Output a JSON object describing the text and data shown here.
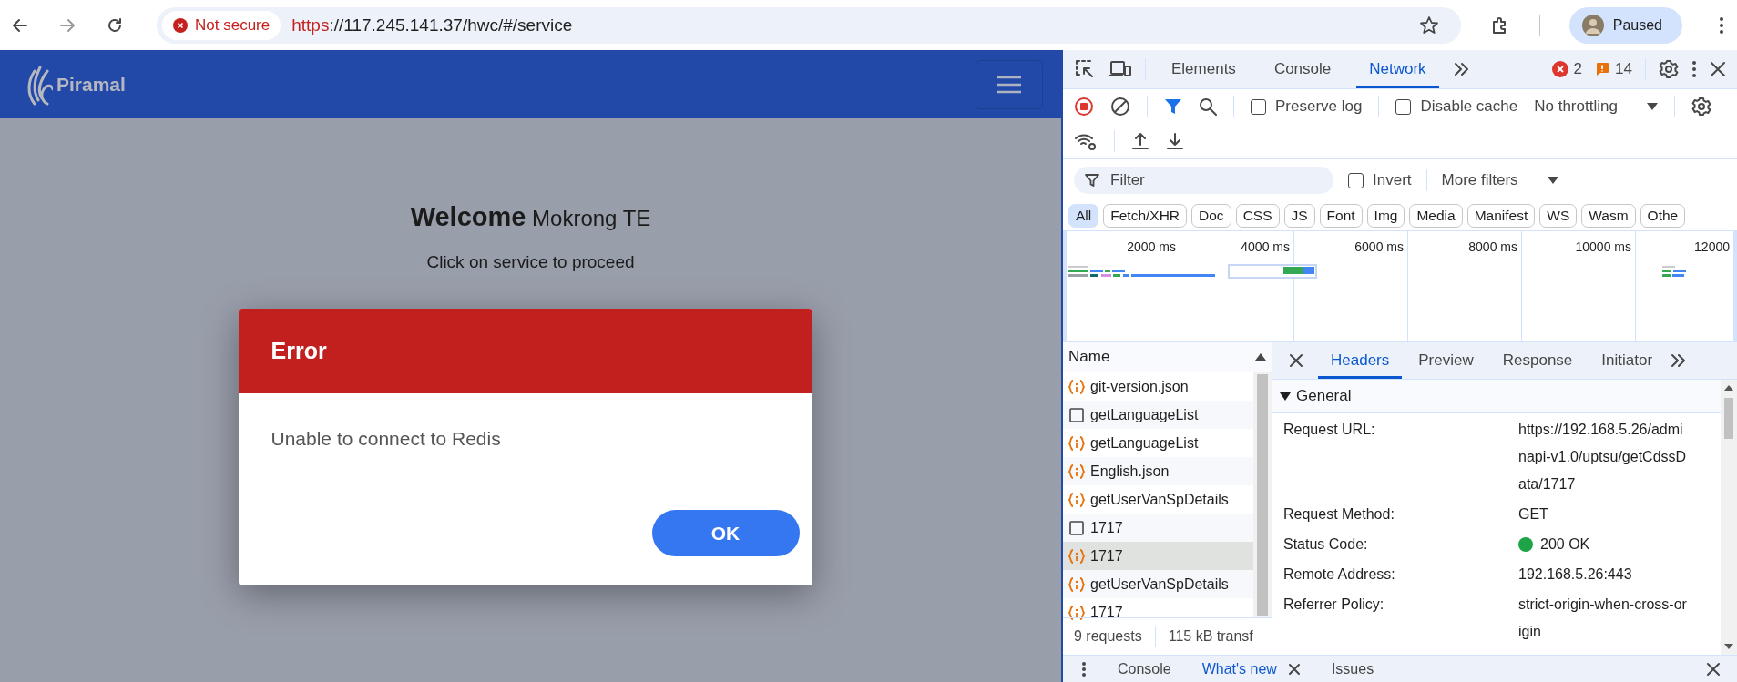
{
  "browser": {
    "security": "Not secure",
    "url_scheme": "https",
    "url_rest": "://117.245.141.37/hwc/#/service",
    "profile": "Paused"
  },
  "page": {
    "logo": "Piramal",
    "welcome": "**Welcome** Mokrong TE",
    "subtitle": "Click on service to proceed",
    "dialog": {
      "title": "Error",
      "message": "Unable to connect to Redis",
      "button": "OK"
    }
  },
  "devtools": {
    "tabs": [
      {
        "label": "Elements",
        "selected": false
      },
      {
        "label": "Console",
        "selected": false
      },
      {
        "label": "Network",
        "selected": true
      }
    ],
    "errors": "2",
    "warnings": "14",
    "preserve_log": {
      "label": "Preserve log",
      "checked": false
    },
    "disable_cache": {
      "label": "Disable cache",
      "checked": false
    },
    "throttling": "No throttling",
    "filter": {
      "placeholder": "Filter"
    },
    "invert": {
      "label": "Invert",
      "checked": false
    },
    "more_filters": "More filters",
    "types": [
      {
        "label": "All",
        "selected": true
      },
      {
        "label": "Fetch/XHR",
        "selected": false
      },
      {
        "label": "Doc",
        "selected": false
      },
      {
        "label": "CSS",
        "selected": false
      },
      {
        "label": "JS",
        "selected": false
      },
      {
        "label": "Font",
        "selected": false
      },
      {
        "label": "Img",
        "selected": false
      },
      {
        "label": "Media",
        "selected": false
      },
      {
        "label": "Manifest",
        "selected": false
      },
      {
        "label": "WS",
        "selected": false
      },
      {
        "label": "Wasm",
        "selected": false
      },
      {
        "label": "Othe",
        "selected": false
      }
    ],
    "timeline_ticks": [
      "2000 ms",
      "4000 ms",
      "6000 ms",
      "8000 ms",
      "10000 ms",
      "12000"
    ],
    "requests": {
      "column": "Name",
      "rows": [
        {
          "name": "git-version.json",
          "kind": "fetch",
          "selected": false
        },
        {
          "name": "getLanguageList",
          "kind": "doc",
          "selected": false
        },
        {
          "name": "getLanguageList",
          "kind": "fetch",
          "selected": false
        },
        {
          "name": "English.json",
          "kind": "fetch",
          "selected": false
        },
        {
          "name": "getUserVanSpDetails",
          "kind": "fetch",
          "selected": false
        },
        {
          "name": "1717",
          "kind": "doc",
          "selected": false
        },
        {
          "name": "1717",
          "kind": "fetch",
          "selected": true
        },
        {
          "name": "getUserVanSpDetails",
          "kind": "fetch",
          "selected": false
        },
        {
          "name": "1717",
          "kind": "fetch",
          "selected": false
        }
      ],
      "count": "9 requests",
      "transferred": "115 kB transf"
    },
    "detail_tabs": [
      {
        "label": "Headers",
        "selected": true
      },
      {
        "label": "Preview",
        "selected": false
      },
      {
        "label": "Response",
        "selected": false
      },
      {
        "label": "Initiator",
        "selected": false
      }
    ],
    "general": {
      "title": "General",
      "expanded": true,
      "rows": [
        {
          "label": "Request URL:",
          "value": "https://192.168.5.26/adminapi-v1.0/uptsu/getCdssData/1717"
        },
        {
          "label": "Request Method:",
          "value": "GET"
        },
        {
          "label": "Status Code:",
          "value": "200 OK",
          "color": "#1ea446"
        },
        {
          "label": "Remote Address:",
          "value": "192.168.5.26:443"
        },
        {
          "label": "Referrer Policy:",
          "value": "strict-origin-when-cross-origin"
        }
      ]
    },
    "drawer_tabs": [
      {
        "label": "Console",
        "selected": false
      },
      {
        "label": "What's new",
        "selected": true,
        "closable": true
      },
      {
        "label": "Issues",
        "selected": false
      }
    ]
  }
}
